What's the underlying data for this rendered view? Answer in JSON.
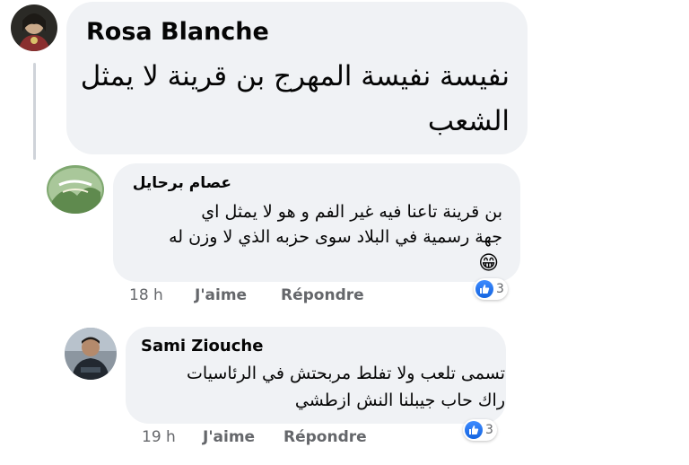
{
  "comments": [
    {
      "author": "Rosa Blanche",
      "lines": [
        "نفيسة نفيسة المهرج بن قرينة لا يمثل",
        "الشعب"
      ]
    },
    {
      "author": "عصام برحايل",
      "lines": [
        "بن قرينة تاعنا فيه غير الفم و هو لا يمثل اي",
        "جهة رسمية في البلاد سوى حزبه الذي لا وزن له"
      ],
      "emoji": "😁",
      "time": "18 h",
      "like_label": "J'aime",
      "reply_label": "Répondre",
      "reaction_count": "3"
    },
    {
      "author": "Sami Ziouche",
      "lines": [
        "تسمى تلعب ولا تفلط مربحتش في الرئاسيات",
        "راك حاب جيبلنا النش ازطشي"
      ],
      "time": "19 h",
      "like_label": "J'aime",
      "reply_label": "Répondre",
      "reaction_count": "3"
    }
  ],
  "icons": {
    "reaction": "like-thumbs-up-icon"
  },
  "colors": {
    "bubble": "#f0f2f5",
    "muted_text": "#65676b",
    "like_blue": "#1877f2"
  }
}
